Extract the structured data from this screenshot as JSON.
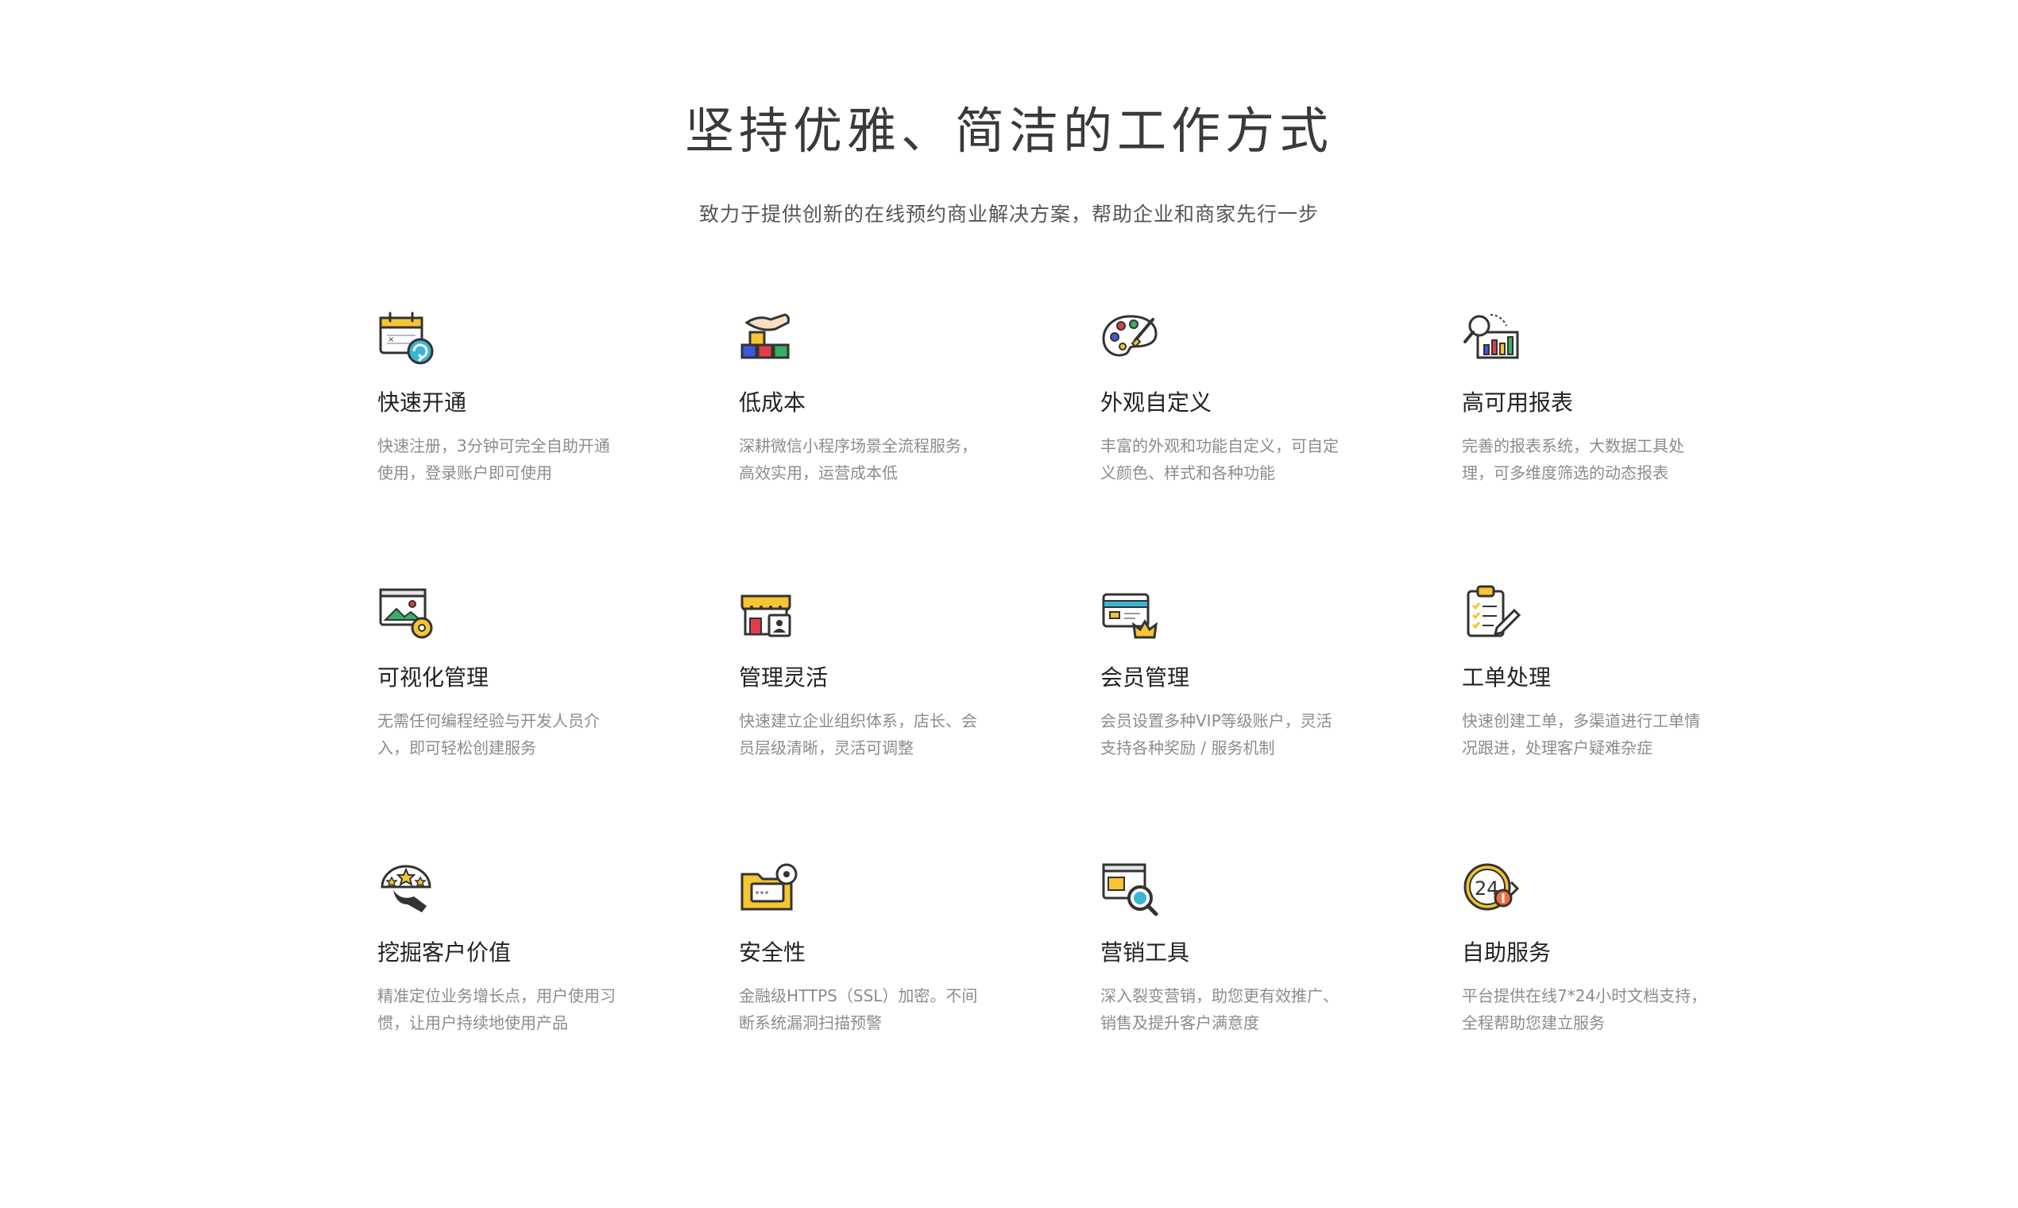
{
  "header": {
    "title": "坚持优雅、简洁的工作方式",
    "subtitle": "致力于提供创新的在线预约商业解决方案，帮助企业和商家先行一步"
  },
  "features": [
    {
      "title": "快速开通",
      "desc": "快速注册，3分钟可完全自助开通使用，登录账户即可使用",
      "icon": "calendar-refresh-icon"
    },
    {
      "title": "低成本",
      "desc": "深耕微信小程序场景全流程服务，高效实用，运营成本低",
      "icon": "hand-blocks-icon"
    },
    {
      "title": "外观自定义",
      "desc": "丰富的外观和功能自定义，可自定义颜色、样式和各种功能",
      "icon": "palette-icon"
    },
    {
      "title": "高可用报表",
      "desc": "完善的报表系统，大数据工具处理，可多维度筛选的动态报表",
      "icon": "report-chart-icon"
    },
    {
      "title": "可视化管理",
      "desc": "无需任何编程经验与开发人员介入，即可轻松创建服务",
      "icon": "image-gear-icon"
    },
    {
      "title": "管理灵活",
      "desc": "快速建立企业组织体系，店长、会员层级清晰，灵活可调整",
      "icon": "store-icon"
    },
    {
      "title": "会员管理",
      "desc": "会员设置多种VIP等级账户，灵活支持各种奖励 / 服务机制",
      "icon": "member-card-crown-icon"
    },
    {
      "title": "工单处理",
      "desc": "快速创建工单，多渠道进行工单情况跟进，处理客户疑难杂症",
      "icon": "clipboard-checklist-icon"
    },
    {
      "title": "挖掘客户价值",
      "desc": "精准定位业务增长点，用户使用习惯，让用户持续地使用产品",
      "icon": "hand-stars-icon"
    },
    {
      "title": "安全性",
      "desc": "金融级HTTPS（SSL）加密。不间断系统漏洞扫描预警",
      "icon": "secure-folder-icon"
    },
    {
      "title": "营销工具",
      "desc": "深入裂变营销，助您更有效推广、销售及提升客户满意度",
      "icon": "marketing-magnifier-icon"
    },
    {
      "title": "自助服务",
      "desc": "平台提供在线7*24小时文档支持，全程帮助您建立服务",
      "icon": "clock-24-icon"
    }
  ],
  "colors": {
    "accent_yellow": "#F7C531",
    "icon_outline": "#333333",
    "title_text": "#222222",
    "desc_text": "#8C8C8C"
  }
}
